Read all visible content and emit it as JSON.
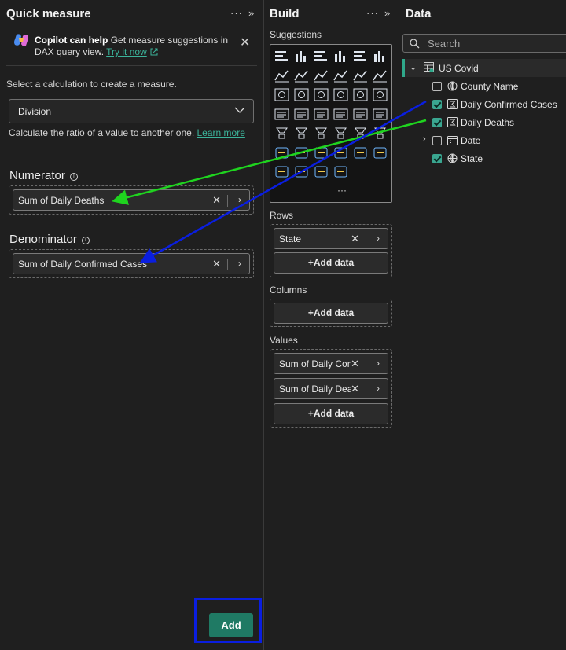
{
  "quick_measure": {
    "title": "Quick measure",
    "more": "···",
    "collapse": "»",
    "copilot": {
      "heading": "Copilot can help",
      "message": "Get measure suggestions in DAX query view.",
      "link": "Try it now"
    },
    "instruction": "Select a calculation to create a measure.",
    "calculation": "Division",
    "description": "Calculate the ratio of a value to another one.",
    "learn_more": "Learn more",
    "numerator_label": "Numerator",
    "numerator_value": "Sum of Daily Deaths",
    "denominator_label": "Denominator",
    "denominator_value": "Sum of Daily Confirmed Cases",
    "add_button": "Add"
  },
  "build": {
    "title": "Build",
    "more": "···",
    "collapse": "»",
    "suggestions_label": "Suggestions",
    "visual_icons": [
      "stacked-bar-icon",
      "stacked-column-icon",
      "clustered-bar-icon",
      "clustered-column-icon",
      "100-bar-icon",
      "100-column-icon",
      "line-chart-icon",
      "area-chart-icon",
      "stacked-area-icon",
      "ribbon-icon",
      "line-column-icon",
      "line-clustered-icon",
      "waterfall-icon",
      "funnel-icon",
      "scatter-icon",
      "pie-icon",
      "donut-icon",
      "treemap-icon",
      "map-icon",
      "filled-map-icon",
      "shape-map-icon",
      "azure-map-icon",
      "gauge-icon",
      "card-icon",
      "multi-row-card-icon",
      "kpi-icon",
      "slicer-icon",
      "table-icon",
      "matrix-icon",
      "r-visual-icon",
      "python-visual-icon",
      "key-influencers-icon",
      "decomposition-tree-icon",
      "qa-icon",
      "narrative-icon",
      "paginated-icon",
      "goals-icon",
      "power-apps-icon",
      "power-automate-icon",
      "more-visuals-icon"
    ],
    "more_visuals": "···",
    "rows_label": "Rows",
    "rows": [
      "State"
    ],
    "columns_label": "Columns",
    "values_label": "Values",
    "values": [
      "Sum of Daily Confirmed Cases",
      "Sum of Daily Deaths"
    ],
    "add_data": "+Add data"
  },
  "data": {
    "title": "Data",
    "search_placeholder": "Search",
    "table": "US Covid",
    "fields": [
      {
        "name": "County Name",
        "checked": false,
        "icon": "globe-icon"
      },
      {
        "name": "Daily Confirmed Cases",
        "checked": true,
        "icon": "sigma-icon"
      },
      {
        "name": "Daily Deaths",
        "checked": true,
        "icon": "sigma-icon"
      },
      {
        "name": "Date",
        "checked": false,
        "icon": "calendar-icon",
        "expandable": true
      },
      {
        "name": "State",
        "checked": true,
        "icon": "globe-icon"
      }
    ]
  },
  "annotations": {
    "green_arrow_color": "#1fd41f",
    "blue_arrow_color": "#0a1ee0",
    "highlight_color": "#0a1ee0"
  }
}
